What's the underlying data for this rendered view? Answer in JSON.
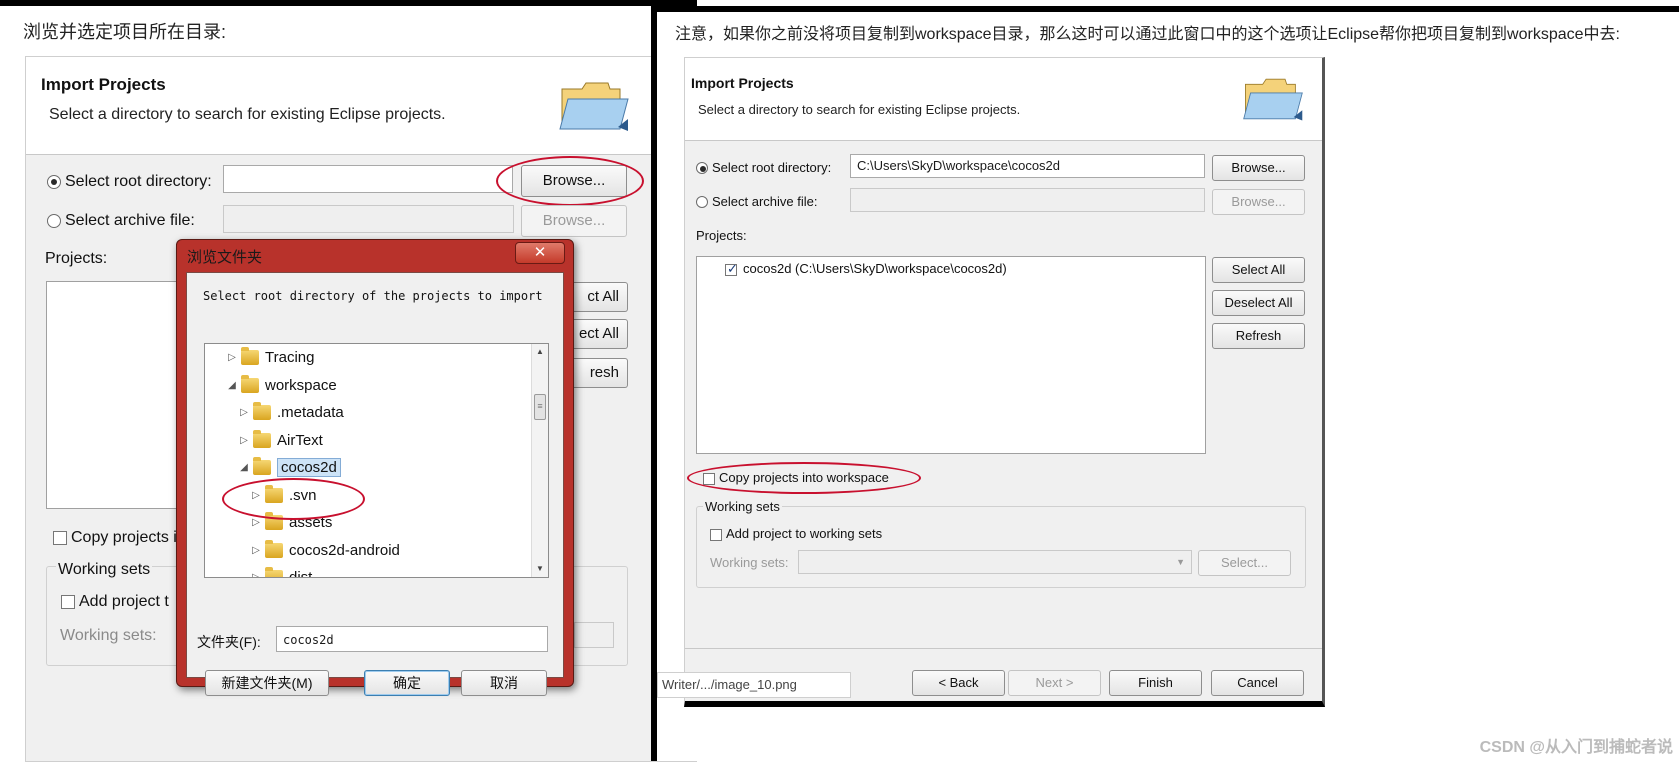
{
  "left": {
    "caption": "浏览并选定项目所在目录:",
    "header": {
      "title": "Import Projects",
      "subtitle": "Select a directory to search for existing Eclipse projects."
    },
    "root_label": "Select root directory:",
    "root_value": "",
    "archive_label": "Select archive file:",
    "browse_label": "Browse...",
    "browse2_label": "Browse...",
    "projects_label": "Projects:",
    "side_buttons": [
      "ct All",
      "ect All",
      "resh"
    ],
    "copy_label": "Copy projects i",
    "working_sets_group": "Working sets",
    "add_working_label": "Add project t",
    "working_sets_field_label": "Working sets:"
  },
  "dialog": {
    "title": "浏览文件夹",
    "close": "✕",
    "prompt": "Select root directory of the projects to import",
    "tree": [
      {
        "label": "Tracing",
        "level": 0,
        "state": "collapsed"
      },
      {
        "label": "workspace",
        "level": 0,
        "state": "expanded"
      },
      {
        "label": ".metadata",
        "level": 1,
        "state": "collapsed"
      },
      {
        "label": "AirText",
        "level": 1,
        "state": "collapsed"
      },
      {
        "label": "cocos2d",
        "level": 1,
        "state": "expanded",
        "selected": true
      },
      {
        "label": ".svn",
        "level": 2,
        "state": "collapsed"
      },
      {
        "label": "assets",
        "level": 2,
        "state": "collapsed"
      },
      {
        "label": "cocos2d-android",
        "level": 2,
        "state": "collapsed"
      },
      {
        "label": "dist",
        "level": 2,
        "state": "collapsed"
      }
    ],
    "folder_label": "文件夹(F):",
    "folder_value": "cocos2d",
    "new_folder": "新建文件夹(M)",
    "ok": "确定",
    "cancel": "取消"
  },
  "right": {
    "caption": "注意，如果你之前没将项目复制到workspace目录，那么这时可以通过此窗口中的这个选项让Eclipse帮你把项目复制到workspace中去:",
    "header": {
      "title": "Import Projects",
      "subtitle": "Select a directory to search for existing Eclipse projects."
    },
    "root_label": "Select root directory:",
    "root_value": "C:\\Users\\SkyD\\workspace\\cocos2d",
    "archive_label": "Select archive file:",
    "browse_label": "Browse...",
    "browse2_label": "Browse...",
    "projects_label": "Projects:",
    "project_item": "cocos2d (C:\\Users\\SkyD\\workspace\\cocos2d)",
    "select_all": "Select All",
    "deselect_all": "Deselect All",
    "refresh": "Refresh",
    "copy_label": "Copy projects into workspace",
    "working_sets_group": "Working sets",
    "add_working_label": "Add project to working sets",
    "working_sets_field_label": "Working sets:",
    "select_btn": "Select...",
    "back": "< Back",
    "next": "Next >",
    "finish": "Finish",
    "cancel": "Cancel",
    "writer_tip": "Writer/.../image_10.png",
    "watermark": "CSDN @从入门到捕蛇者说"
  },
  "colors": {
    "highlight_ellipse": "#c8102e",
    "dialog_frame": "#b8322b",
    "selection": "#cde3f7"
  }
}
